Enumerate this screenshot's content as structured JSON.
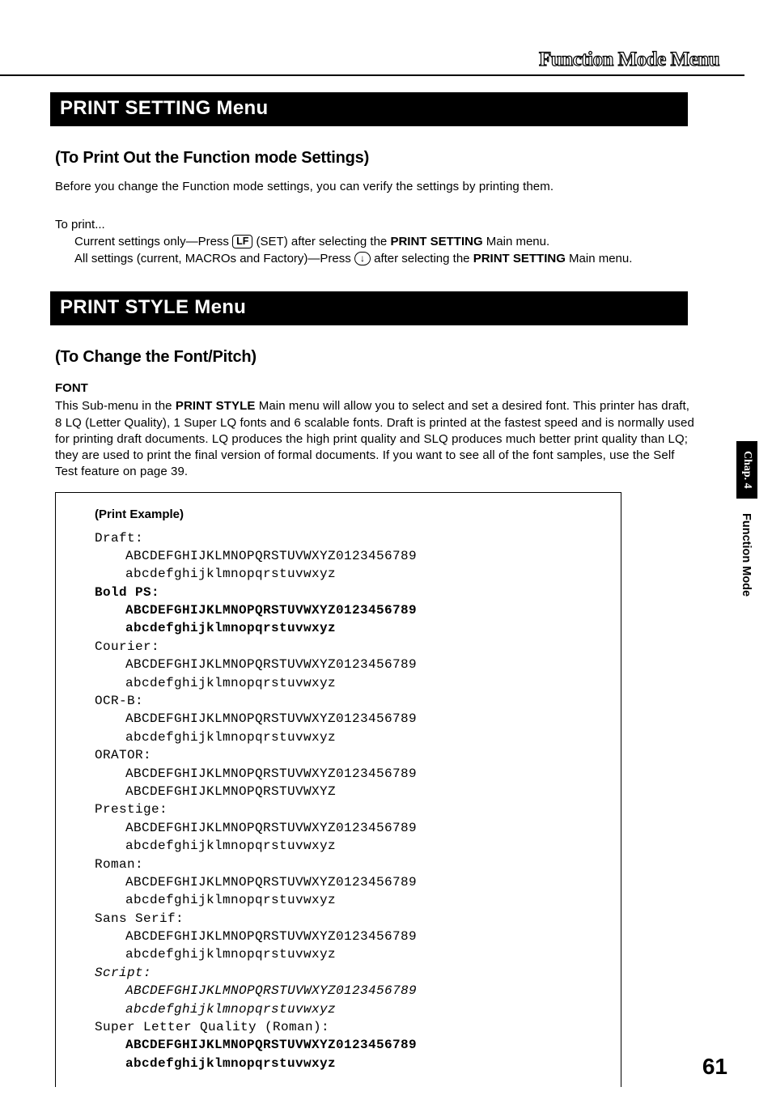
{
  "header": {
    "outline_title": "Function Mode Menu"
  },
  "section1": {
    "bar": "PRINT SETTING Menu",
    "subtitle": "(To Print Out the Function mode Settings)",
    "intro": "Before you change the Function mode settings, you can verify the settings by printing them.",
    "toprint": "To print...",
    "line1_a": "Current settings only—Press ",
    "key_lf": "LF",
    "line1_b": " (SET) after selecting the ",
    "line1_bold": "PRINT SETTING",
    "line1_c": " Main menu.",
    "line2_a": "All settings (current, MACROs and Factory)—Press ",
    "key_down": "↓",
    "line2_b": " after selecting the ",
    "line2_bold": "PRINT SETTING",
    "line2_c": " Main menu."
  },
  "section2": {
    "bar": "PRINT STYLE Menu",
    "subtitle": "(To Change the Font/Pitch)",
    "font_label": "FONT",
    "desc_a": "This Sub-menu in the ",
    "desc_bold": "PRINT STYLE",
    "desc_b": " Main menu will allow you to select and set a desired font. This printer has draft, 8 LQ (Letter Quality), 1 Super LQ fonts and 6 scalable fonts. Draft is printed at the fastest speed and is normally used for printing draft documents. LQ produces the high print quality and SLQ produces much better print quality than LQ;  they are used to print the final version of formal documents. If you want to see all of the font samples, use the Self Test feature on page 39."
  },
  "example": {
    "title": "(Print Example)",
    "upper": "ABCDEFGHIJKLMNOPQRSTUVWXYZ0123456789",
    "lower": "abcdefghijklmnopqrstuvwxyz",
    "orator_lower": "ABCDEFGHIJKLMNOPQRSTUVWXYZ",
    "fonts": {
      "draft": "Draft:",
      "boldps": "Bold PS:",
      "courier": "Courier:",
      "ocrb": "OCR-B:",
      "orator": "ORATOR:",
      "prestige": "Prestige:",
      "roman": "Roman:",
      "sans": "Sans Serif:",
      "script": "Script:",
      "slq": "Super Letter Quality (Roman):"
    }
  },
  "sidebar": {
    "tab_black": "Chap. 4",
    "tab_white": "Function Mode"
  },
  "page_number": "61"
}
